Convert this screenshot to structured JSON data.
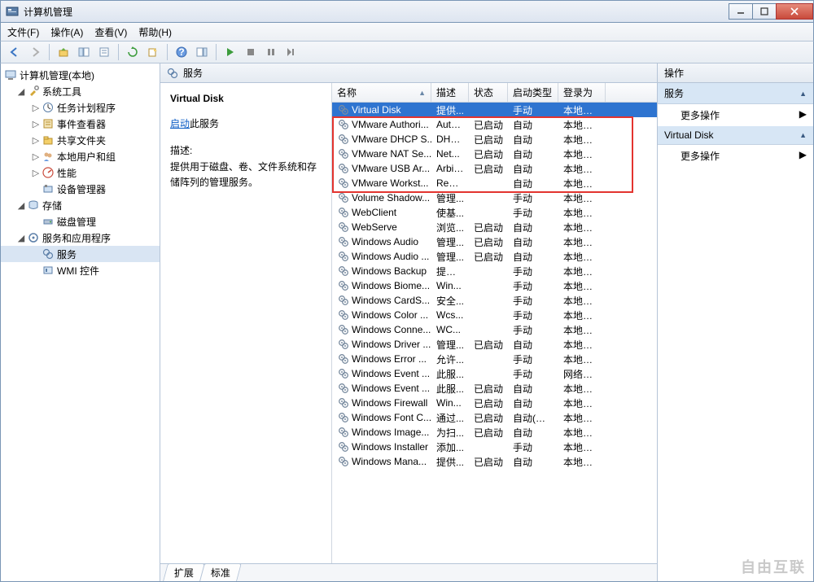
{
  "title": "计算机管理",
  "menu": {
    "file": "文件(F)",
    "action": "操作(A)",
    "view": "查看(V)",
    "help": "帮助(H)"
  },
  "tree": {
    "root": "计算机管理(本地)",
    "systools": "系统工具",
    "scheduler": "任务计划程序",
    "eventviewer": "事件查看器",
    "shared": "共享文件夹",
    "localusers": "本地用户和组",
    "perf": "性能",
    "devmgr": "设备管理器",
    "storage": "存储",
    "diskmgmt": "磁盘管理",
    "svcapp": "服务和应用程序",
    "services": "服务",
    "wmi": "WMI 控件"
  },
  "center": {
    "header": "服务",
    "selectedTitle": "Virtual Disk",
    "startLink": "启动",
    "startLinkSuffix": "此服务",
    "descLabel": "描述:",
    "descText": "提供用于磁盘、卷、文件系统和存储阵列的管理服务。"
  },
  "columns": {
    "name": "名称",
    "desc": "描述",
    "status": "状态",
    "startup": "启动类型",
    "logon": "登录为"
  },
  "services": [
    {
      "name": "Virtual Disk",
      "desc": "提供...",
      "status": "",
      "startup": "手动",
      "logon": "本地系统",
      "selected": true
    },
    {
      "name": "VMware Authori...",
      "desc": "Auth...",
      "status": "已启动",
      "startup": "自动",
      "logon": "本地系统",
      "hl": true
    },
    {
      "name": "VMware DHCP S...",
      "desc": "DHC...",
      "status": "已启动",
      "startup": "自动",
      "logon": "本地系统",
      "hl": true
    },
    {
      "name": "VMware NAT Se...",
      "desc": "Net...",
      "status": "已启动",
      "startup": "自动",
      "logon": "本地系统",
      "hl": true
    },
    {
      "name": "VMware USB Ar...",
      "desc": "Arbit...",
      "status": "已启动",
      "startup": "自动",
      "logon": "本地系统",
      "hl": true
    },
    {
      "name": "VMware Workst...",
      "desc": "Rem...",
      "status": "",
      "startup": "自动",
      "logon": "本地系统",
      "hl": true
    },
    {
      "name": "Volume Shadow...",
      "desc": "管理...",
      "status": "",
      "startup": "手动",
      "logon": "本地系统"
    },
    {
      "name": "WebClient",
      "desc": "使基...",
      "status": "",
      "startup": "手动",
      "logon": "本地服务"
    },
    {
      "name": "WebServe",
      "desc": "浏览...",
      "status": "已启动",
      "startup": "自动",
      "logon": "本地系统"
    },
    {
      "name": "Windows Audio",
      "desc": "管理...",
      "status": "已启动",
      "startup": "自动",
      "logon": "本地服务"
    },
    {
      "name": "Windows Audio ...",
      "desc": "管理...",
      "status": "已启动",
      "startup": "自动",
      "logon": "本地系统"
    },
    {
      "name": "Windows Backup",
      "desc": "提供 ...",
      "status": "",
      "startup": "手动",
      "logon": "本地系统"
    },
    {
      "name": "Windows Biome...",
      "desc": "Win...",
      "status": "",
      "startup": "手动",
      "logon": "本地系统"
    },
    {
      "name": "Windows CardS...",
      "desc": "安全...",
      "status": "",
      "startup": "手动",
      "logon": "本地系统"
    },
    {
      "name": "Windows Color ...",
      "desc": "Wcs...",
      "status": "",
      "startup": "手动",
      "logon": "本地服务"
    },
    {
      "name": "Windows Conne...",
      "desc": "WC...",
      "status": "",
      "startup": "手动",
      "logon": "本地服务"
    },
    {
      "name": "Windows Driver ...",
      "desc": "管理...",
      "status": "已启动",
      "startup": "自动",
      "logon": "本地系统"
    },
    {
      "name": "Windows Error ...",
      "desc": "允许...",
      "status": "",
      "startup": "手动",
      "logon": "本地系统"
    },
    {
      "name": "Windows Event ...",
      "desc": "此服...",
      "status": "",
      "startup": "手动",
      "logon": "网络服务"
    },
    {
      "name": "Windows Event ...",
      "desc": "此服...",
      "status": "已启动",
      "startup": "自动",
      "logon": "本地服务"
    },
    {
      "name": "Windows Firewall",
      "desc": "Win...",
      "status": "已启动",
      "startup": "自动",
      "logon": "本地服务"
    },
    {
      "name": "Windows Font C...",
      "desc": "通过...",
      "status": "已启动",
      "startup": "自动(延迟...",
      "logon": "本地服务"
    },
    {
      "name": "Windows Image...",
      "desc": "为扫...",
      "status": "已启动",
      "startup": "自动",
      "logon": "本地服务"
    },
    {
      "name": "Windows Installer",
      "desc": "添加...",
      "status": "",
      "startup": "手动",
      "logon": "本地系统"
    },
    {
      "name": "Windows Mana...",
      "desc": "提供...",
      "status": "已启动",
      "startup": "自动",
      "logon": "本地系统"
    }
  ],
  "bottomTabs": {
    "extended": "扩展",
    "standard": "标准"
  },
  "actions": {
    "header": "操作",
    "section1": "服务",
    "more": "更多操作",
    "section2": "Virtual Disk"
  },
  "watermark": "自由互联"
}
